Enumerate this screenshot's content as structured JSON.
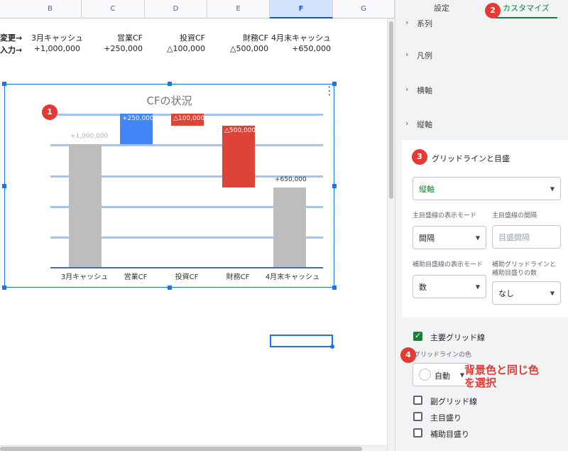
{
  "columns": [
    "B",
    "C",
    "D",
    "E",
    "F",
    "G"
  ],
  "rows": {
    "row1": [
      "変更→",
      "3月キャッシュ",
      "営業CF",
      "投資CF",
      "財務CF",
      "4月末キャッシュ"
    ],
    "row2": [
      "入力→",
      "+1,000,000",
      "+250,000",
      "△100,000",
      "△500,000",
      "+650,000"
    ]
  },
  "chart": {
    "title": "CFの状況",
    "menu_icon": "⋮",
    "categories": [
      "3月キャッシュ",
      "営業CF",
      "投資CF",
      "財務CF",
      "4月末キャッシュ"
    ],
    "labels": [
      "+1,000,000",
      "+250,000",
      "△100,000",
      "△500,000",
      "+650,000"
    ]
  },
  "chart_data": {
    "type": "bar",
    "subtype": "waterfall",
    "title": "CFの状況",
    "categories": [
      "3月キャッシュ",
      "営業CF",
      "投資CF",
      "財務CF",
      "4月末キャッシュ"
    ],
    "values": [
      1000000,
      250000,
      -100000,
      -500000,
      650000
    ],
    "data_labels": [
      "+1,000,000",
      "+250,000",
      "△100,000",
      "△500,000",
      "+650,000"
    ],
    "colors": {
      "total": "#bdbdbd",
      "increase": "#4285f4",
      "decrease": "#db4437"
    },
    "ylim": [
      0,
      1250000
    ],
    "grid": true,
    "legend": "none"
  },
  "badges": [
    "1",
    "2",
    "3",
    "4"
  ],
  "panel": {
    "tabs": [
      "設定",
      "カスタマイズ"
    ],
    "accordion": [
      "系列",
      "凡例",
      "横軸",
      "縦軸"
    ],
    "section_title": "グリッドラインと目盛",
    "axis_select": "縦軸",
    "major_mode_label": "主目盛線の表示モード",
    "major_mode_value": "間隔",
    "major_interval_label": "主目盛線の間隔",
    "major_interval_placeholder": "目盛間隔",
    "minor_mode_label": "補助目盛線の表示モード",
    "minor_mode_value": "数",
    "minor_count_label_1": "補助グリッドラインと",
    "minor_count_label_2": "補助目盛りの数",
    "minor_count_value": "なし",
    "major_grid_label": "主要グリッド線",
    "grid_color_label": "グリッドラインの色",
    "grid_color_value": "自動",
    "annotation_line1": "背景色と同じ色",
    "annotation_line2": "を選択",
    "minor_grid_label": "副グリッド線",
    "major_tick_label": "主目盛り",
    "minor_tick_label": "補助目盛り"
  },
  "colors": {
    "accent": "#1a73e8",
    "active_tab": "#0b8043",
    "badge": "#e53935",
    "annotation": "#e53935"
  }
}
